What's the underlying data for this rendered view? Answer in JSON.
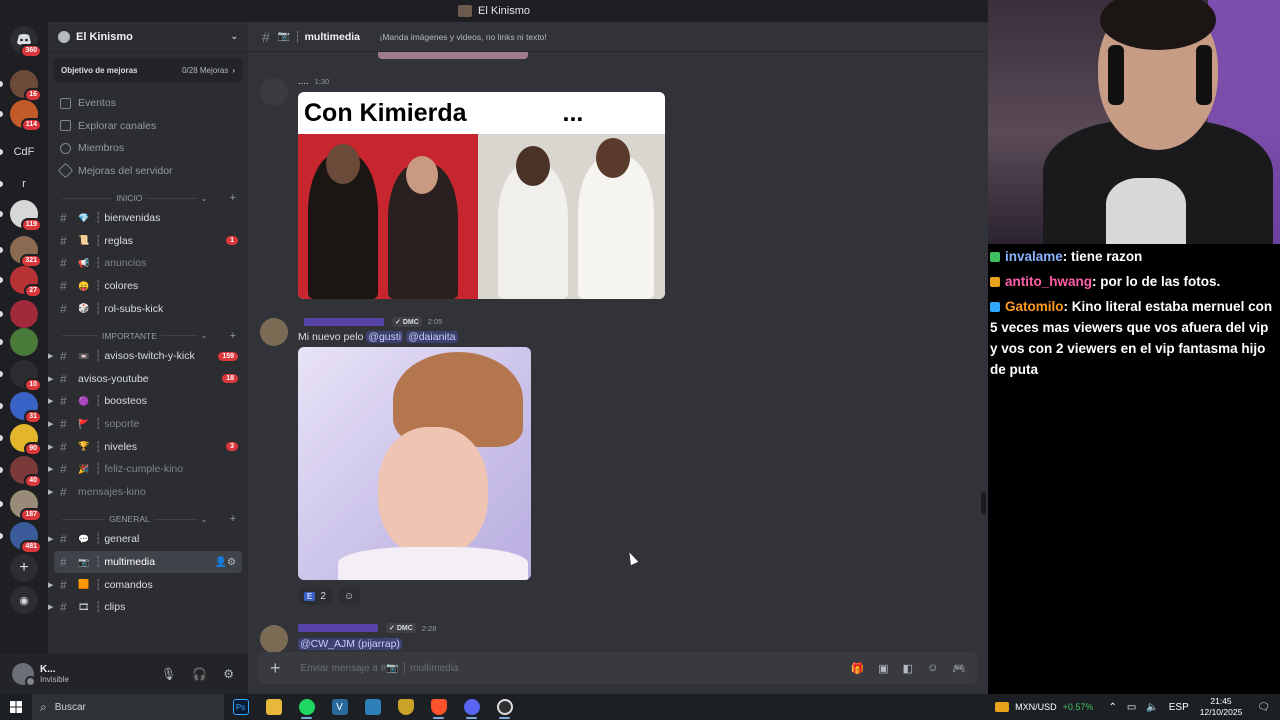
{
  "window": {
    "title": "El Kinismo"
  },
  "rail": {
    "home_badge": "360",
    "servers": [
      {
        "label": "",
        "badge": "16",
        "color": "#6b4a3a"
      },
      {
        "label": "",
        "badge": "114",
        "color": "#c25a2a"
      },
      {
        "label": "CdF",
        "badge": "",
        "color": "#1e1f22"
      },
      {
        "label": "r",
        "badge": "",
        "color": "#1e1f22"
      },
      {
        "label": "",
        "badge": "119",
        "color": "#d7d7d7"
      },
      {
        "label": "",
        "badge": "321",
        "color": "#8a6a50"
      },
      {
        "label": "",
        "badge": "27",
        "color": "#b83333"
      },
      {
        "label": "",
        "badge": "",
        "color": "#a02a3a"
      },
      {
        "label": "",
        "badge": "",
        "color": "#4a7a3a"
      },
      {
        "label": "",
        "badge": "10",
        "color": "#2b2d31"
      },
      {
        "label": "",
        "badge": "31",
        "color": "#3a63c8"
      },
      {
        "label": "",
        "badge": "90",
        "color": "#e2b52b"
      },
      {
        "label": "",
        "badge": "40",
        "color": "#7a3a3a"
      },
      {
        "label": "",
        "badge": "187",
        "color": "#9a8a7a"
      },
      {
        "label": "",
        "badge": "481",
        "color": "#3a5a9a"
      }
    ],
    "add_icon": "plus-icon",
    "discover_icon": "compass-icon"
  },
  "server": {
    "name": "El Kinismo",
    "goal_label": "Objetivo de mejoras",
    "goal_count": "0/28 Mejoras",
    "nav": [
      "Eventos",
      "Explorar canales",
      "Miembros",
      "Mejoras del servidor"
    ]
  },
  "categories": {
    "inicio": "INICIO",
    "importante": "IMPORTANTE",
    "general": "GENERAL"
  },
  "channels_inicio": [
    {
      "emoji": "💎",
      "name": "bienvenidas",
      "badge": "",
      "muted": false
    },
    {
      "emoji": "📜",
      "name": "reglas",
      "badge": "1",
      "muted": false
    },
    {
      "emoji": "📢",
      "name": "anuncios",
      "badge": "",
      "muted": true
    },
    {
      "emoji": "😛",
      "name": "colores",
      "badge": "",
      "muted": false
    },
    {
      "emoji": "🎲",
      "name": "rol-subs-kick",
      "badge": "",
      "muted": false
    }
  ],
  "channels_importante": [
    {
      "emoji": "📼",
      "name": "avisos-twitch-y-kick",
      "badge": "159",
      "muted": false
    },
    {
      "emoji": "",
      "name": "avisos-youtube",
      "badge": "18",
      "muted": false
    },
    {
      "emoji": "🟣",
      "name": "boosteos",
      "badge": "",
      "muted": false
    },
    {
      "emoji": "🚩",
      "name": "soporte",
      "badge": "",
      "muted": true
    },
    {
      "emoji": "🏆",
      "name": "niveles",
      "badge": "3",
      "muted": false
    },
    {
      "emoji": "🎉",
      "name": "feliz-cumple-kino",
      "badge": "",
      "muted": true
    },
    {
      "emoji": "",
      "name": "mensajes-kino",
      "badge": "",
      "muted": true
    }
  ],
  "channels_general": [
    {
      "emoji": "💬",
      "name": "general",
      "active": false
    },
    {
      "emoji": "📷",
      "name": "multimedia",
      "active": true
    },
    {
      "emoji": "🟧",
      "name": "comandos",
      "active": false
    },
    {
      "emoji": "🎞",
      "name": "clips",
      "active": false
    }
  ],
  "user": {
    "name": "K...",
    "status": "Invisible"
  },
  "channel_header": {
    "name": "multimedia",
    "topic": "¡Manda imágenes y videos, no links ni texto!"
  },
  "messages": {
    "m1": {
      "name": "....",
      "time": "1:30",
      "meme_caption": "Con Kimierda",
      "meme_dots": "..."
    },
    "m2": {
      "tag": "DMC",
      "time": "2:05",
      "text": "Mi nuevo pelo",
      "mention1": "@gusti",
      "mention2": "@daianita",
      "react_count": "2"
    },
    "m3": {
      "tag": "DMC",
      "time": "2:28",
      "mention": "@CW_AJM (pijarrap)"
    }
  },
  "composer": {
    "placeholder": "Enviar mensaje a #📷 ┆ multimedia"
  },
  "stream_chat": [
    {
      "user": "invalame",
      "user_color": "#8ab4ff",
      "text": ": tiene razon"
    },
    {
      "user": "antito_hwang",
      "user_color": "#ff5fa8",
      "text": ": por lo de las fotos."
    },
    {
      "user": "Gatomilo",
      "user_color": "#ff9a1f",
      "text": ": Kino literal estaba mernuel con 5 veces mas viewers que vos afuera del vip y vos con 2 viewers en el vip fantasma hijo de puta"
    }
  ],
  "taskbar": {
    "search": "Buscar",
    "fx_pair": "MXN/USD",
    "fx_change": "+0.57%",
    "lang": "ESP",
    "time": "21:45",
    "date": "12/10/2025"
  }
}
